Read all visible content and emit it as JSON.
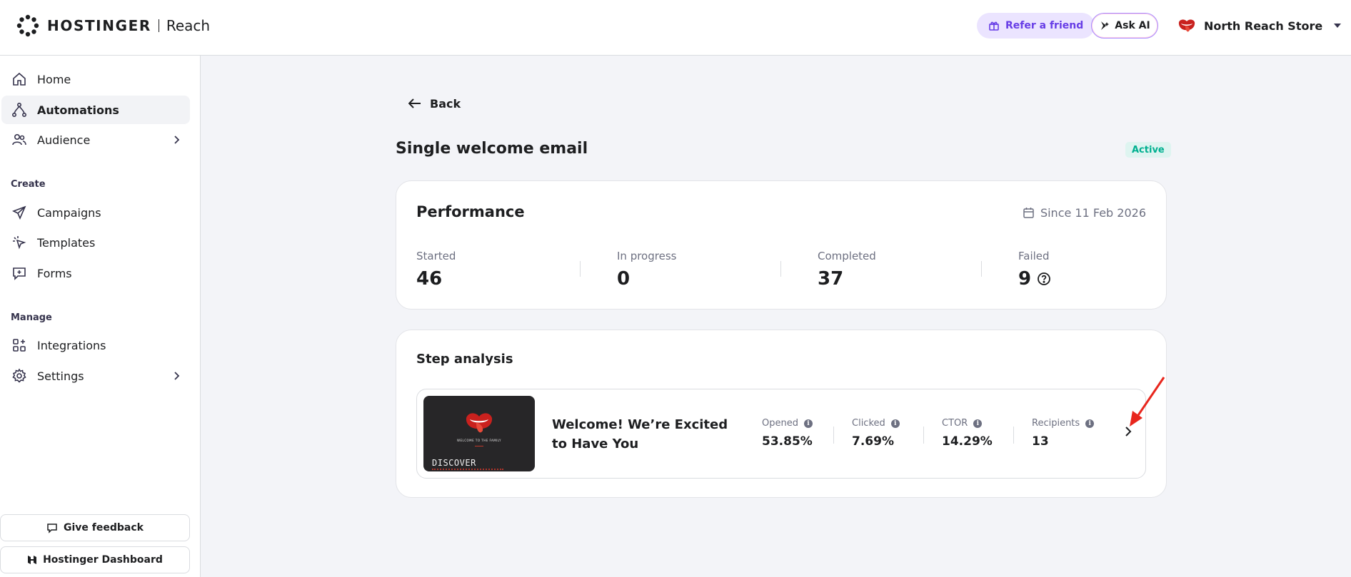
{
  "header": {
    "brand": "HOSTINGER",
    "product": "Reach",
    "refer_label": "Refer a friend",
    "askai_label": "Ask AI",
    "store_name": "North Reach Store"
  },
  "sidebar": {
    "items_top": [
      {
        "label": "Home",
        "icon": "home-icon"
      },
      {
        "label": "Automations",
        "icon": "automations-icon"
      },
      {
        "label": "Audience",
        "icon": "audience-icon"
      }
    ],
    "section_create": "Create",
    "items_create": [
      {
        "label": "Campaigns",
        "icon": "send-icon"
      },
      {
        "label": "Templates",
        "icon": "templates-icon"
      },
      {
        "label": "Forms",
        "icon": "forms-icon"
      }
    ],
    "section_manage": "Manage",
    "items_manage": [
      {
        "label": "Integrations",
        "icon": "integrations-icon"
      },
      {
        "label": "Settings",
        "icon": "gear-icon"
      }
    ],
    "feedback_label": "Give feedback",
    "dashboard_label": "Hostinger Dashboard"
  },
  "main": {
    "back_label": "Back",
    "title": "Single welcome email",
    "status": "Active",
    "performance": {
      "title": "Performance",
      "since": "Since 11 Feb 2026",
      "stats": [
        {
          "label": "Started",
          "value": "46"
        },
        {
          "label": "In progress",
          "value": "0"
        },
        {
          "label": "Completed",
          "value": "37"
        },
        {
          "label": "Failed",
          "value": "9"
        }
      ]
    },
    "step_analysis": {
      "title": "Step analysis",
      "thumb_caption": "WELCOME TO THE FAMILY",
      "thumb_cta": "DISCOVER",
      "email_title": "Welcome! We’re Excited to Have You",
      "metrics": [
        {
          "label": "Opened",
          "value": "53.85%"
        },
        {
          "label": "Clicked",
          "value": "7.69%"
        },
        {
          "label": "CTOR",
          "value": "14.29%"
        },
        {
          "label": "Recipients",
          "value": "13"
        }
      ]
    }
  },
  "colors": {
    "brand_purple": "#673de6",
    "active_green": "#00b090",
    "annotation_red": "#e8261d"
  }
}
